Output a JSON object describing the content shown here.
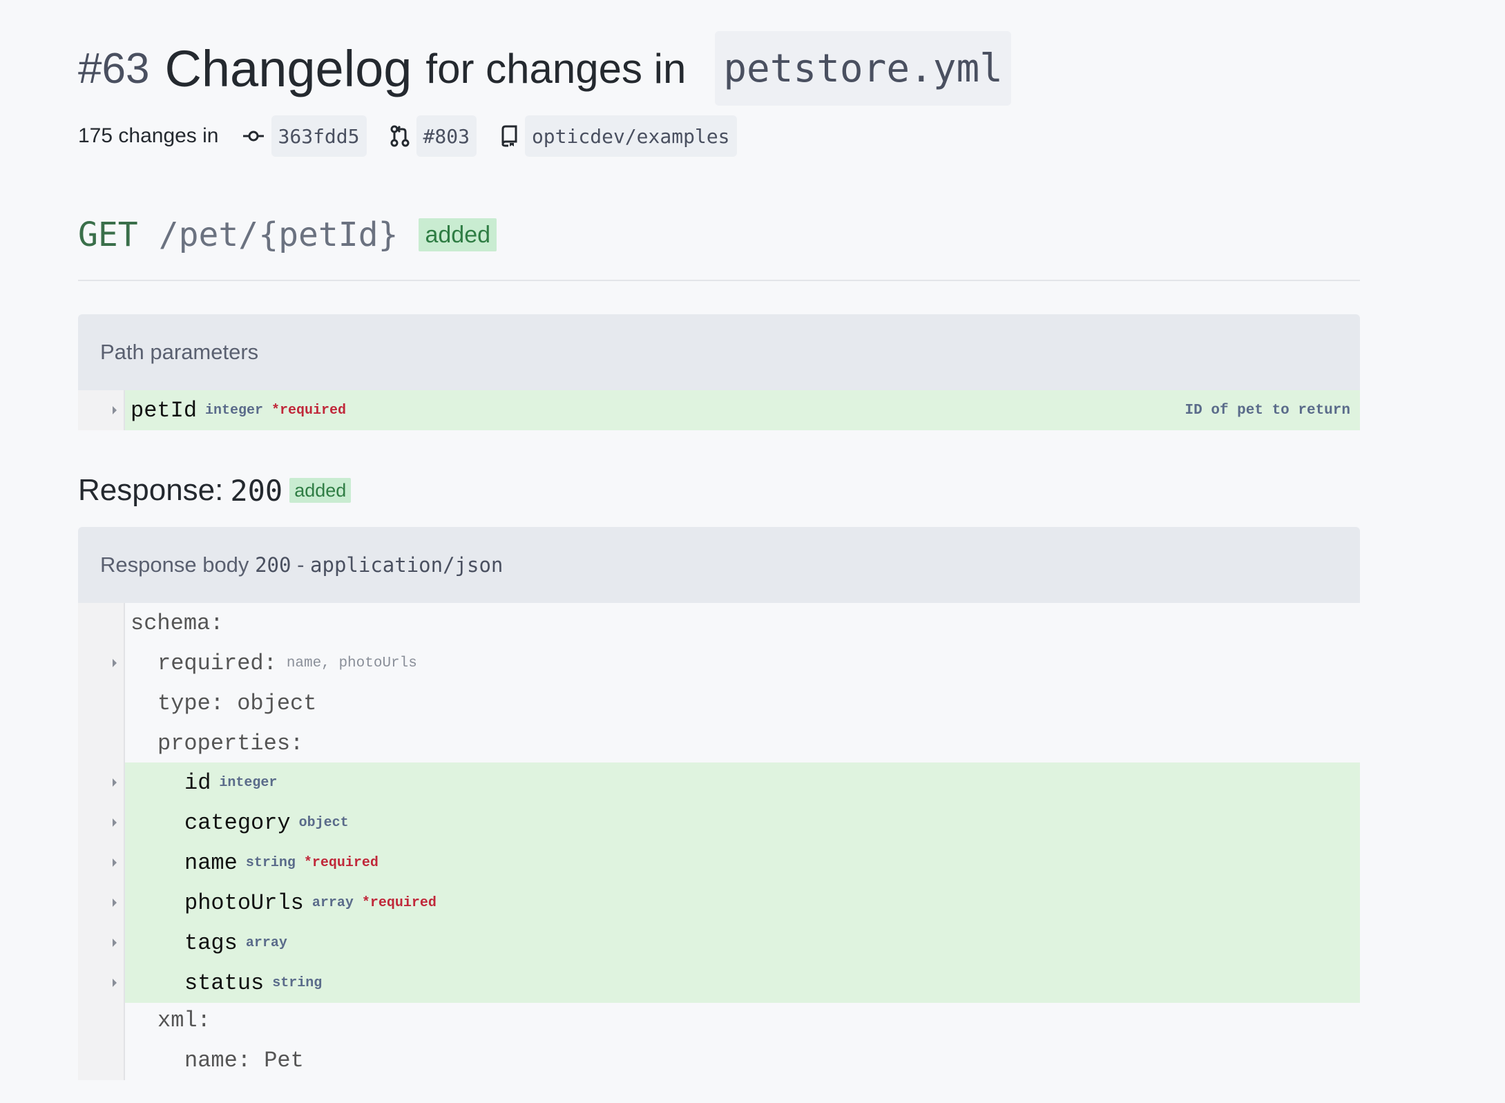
{
  "header": {
    "number": "#63",
    "changelog": "Changelog",
    "for_changes_in": "for changes in",
    "file": "petstore.yml"
  },
  "meta": {
    "changes_text": "175 changes in",
    "commit": "363fdd5",
    "pull_request": "#803",
    "repo": "opticdev/examples",
    "icons": [
      "commit-icon",
      "pull-request-icon",
      "repo-icon"
    ]
  },
  "endpoint": {
    "method": "GET",
    "path": "/pet/{petId}",
    "badge": "added"
  },
  "path_params": {
    "title": "Path parameters",
    "param": {
      "name": "petId",
      "type": "integer",
      "required": "*required",
      "description": "ID of pet to return"
    }
  },
  "response": {
    "label": "Response:",
    "code": "200",
    "badge": "added",
    "body_title": "Response body",
    "body_code": "200",
    "body_sep": "-",
    "content_type": "application/json"
  },
  "schema": {
    "schema_key": "schema:",
    "required_key": "required:",
    "required_values": "name, photoUrls",
    "type_line": "type: object",
    "properties_key": "properties:",
    "properties": [
      {
        "name": "id",
        "type": "integer",
        "required": ""
      },
      {
        "name": "category",
        "type": "object",
        "required": ""
      },
      {
        "name": "name",
        "type": "string",
        "required": "*required"
      },
      {
        "name": "photoUrls",
        "type": "array",
        "required": "*required"
      },
      {
        "name": "tags",
        "type": "array",
        "required": ""
      },
      {
        "name": "status",
        "type": "string",
        "required": ""
      }
    ],
    "xml_key": "xml:",
    "xml_name": "name: Pet"
  },
  "colors": {
    "added_bg": "#dff3df",
    "badge_bg": "#c9ecd1",
    "badge_text": "#2f7d44",
    "required": "#c0283a",
    "method": "#3a6f4a"
  }
}
